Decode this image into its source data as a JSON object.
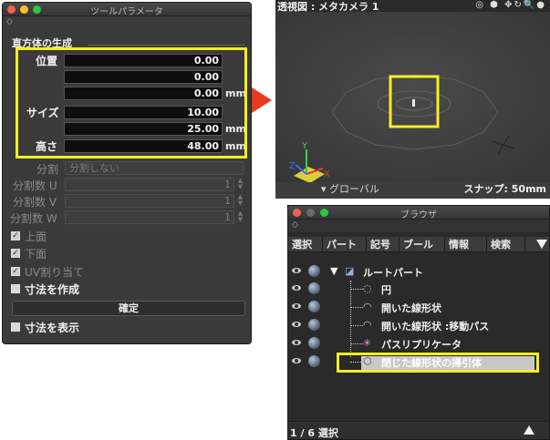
{
  "tool_panel": {
    "title": "ツールパラメータ",
    "group_title": "直方体の生成",
    "position": {
      "label": "位置",
      "values": [
        "0.00",
        "0.00",
        "0.00"
      ],
      "unit": "mm"
    },
    "size": {
      "label": "サイズ",
      "values": [
        "10.00",
        "25.00"
      ],
      "unit": "mm"
    },
    "height": {
      "label": "高さ",
      "value": "48.00",
      "unit": "mm"
    },
    "division": {
      "label": "分割",
      "value": "分割しない"
    },
    "div_u": {
      "label": "分割数 U",
      "value": "1"
    },
    "div_v": {
      "label": "分割数 V",
      "value": "1"
    },
    "div_w": {
      "label": "分割数 W",
      "value": "1"
    },
    "checkboxes": [
      {
        "label": "上面",
        "checked": true
      },
      {
        "label": "下面",
        "checked": true
      },
      {
        "label": "UV割り当て",
        "checked": true
      }
    ],
    "create_dimension_label": "寸法を作成",
    "confirm_label": "確定",
    "show_dimension_label": "寸法を表示"
  },
  "viewport": {
    "title": "透視図 : メタカメラ 1",
    "global_label": "▾ グローバル",
    "snap_label": "スナップ: 50mm",
    "axes": {
      "x": "X",
      "y": "Y",
      "z": "Z"
    }
  },
  "browser": {
    "title": "ブラウザ",
    "tabs": [
      "選択",
      "パート",
      "記号",
      "ブール",
      "情報",
      "検索"
    ],
    "tree": [
      {
        "label": "ルートパート",
        "icon": "root-part-icon"
      },
      {
        "label": "円",
        "icon": "circle-icon"
      },
      {
        "label": "開いた線形状",
        "icon": "open-line-icon"
      },
      {
        "label": "開いた線形状 :移動パス",
        "icon": "open-line-icon"
      },
      {
        "label": "パスリプリケータ",
        "icon": "path-replicator-icon"
      },
      {
        "label": "閉じた線形状の掃引体",
        "icon": "sweep-icon"
      }
    ],
    "status": "1 / 6 選択"
  },
  "colors": {
    "highlight": "#f4ee26",
    "arrow": "#e63b1f"
  }
}
